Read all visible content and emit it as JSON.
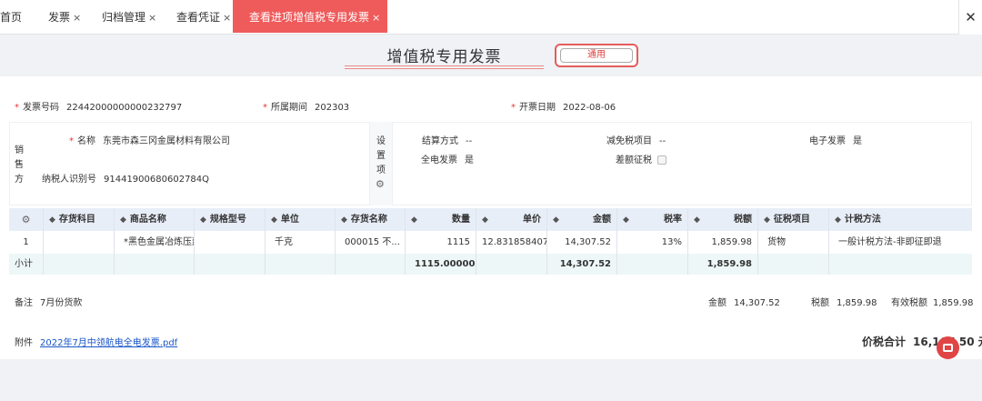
{
  "tabs": [
    {
      "label": "首页",
      "closable": false
    },
    {
      "label": "发票",
      "closable": true
    },
    {
      "label": "归档管理",
      "closable": true
    },
    {
      "label": "查看凭证",
      "closable": true
    },
    {
      "label": "查看进项增值税专用发票",
      "closable": true,
      "active": true
    }
  ],
  "close_glyph": "×",
  "window_close": "✕",
  "title": "增值税专用发票",
  "general_button": "通用",
  "header_fields": {
    "invoice_no_label": "发票号码",
    "invoice_no": "22442000000000232797",
    "period_label": "所属期间",
    "period": "202303",
    "date_label": "开票日期",
    "date": "2022-08-06"
  },
  "seller": {
    "section_label": "销售方",
    "name_label": "名称",
    "name": "东莞市森三冈金属材料有限公司",
    "tax_id_label": "纳税人识别号",
    "tax_id": "91441900680602784Q"
  },
  "settings": {
    "section_label": "设置项",
    "settlement_label": "结算方式",
    "settlement": "--",
    "reduction_label": "减免税项目",
    "reduction": "--",
    "e_invoice_label": "电子发票",
    "e_invoice": "是",
    "full_e_label": "全电发票",
    "full_e": "是",
    "diff_tax_label": "差额征税",
    "diff_tax_checked": false
  },
  "table": {
    "headers": [
      "存货科目",
      "商品名称",
      "规格型号",
      "单位",
      "存货名称",
      "数量",
      "单价",
      "金额",
      "税率",
      "税额",
      "征税项目",
      "计税方法"
    ],
    "rows": [
      {
        "index": "1",
        "subject": "",
        "goods": "*黑色金属冶炼压延",
        "spec": "",
        "unit": "千克",
        "inv_name": "000015 不...",
        "qty": "1115",
        "price": "12.8318584071",
        "amount": "14,307.52",
        "rate": "13%",
        "tax": "1,859.98",
        "tax_item": "货物",
        "method": "一般计税方法-非即征即退"
      }
    ],
    "subtotal": {
      "label": "小计",
      "qty": "1115.00000...",
      "amount": "14,307.52",
      "tax": "1,859.98"
    }
  },
  "footer": {
    "remark_label": "备注",
    "remark": "7月份货款",
    "amount_label": "金额",
    "amount": "14,307.52",
    "tax_label": "税额",
    "tax": "1,859.98",
    "effective_tax_label": "有效税额",
    "effective_tax": "1,859.98",
    "attachment_label": "附件",
    "attachment": "2022年7月中领航电全电发票.pdf",
    "total_label": "价税合计",
    "total": "16,167.50",
    "currency": "元"
  },
  "colors": {
    "accent": "#ef5b5b",
    "link": "#1a56c8",
    "header_bg": "#e8eef8",
    "subtotal_bg": "#eef7f8"
  }
}
